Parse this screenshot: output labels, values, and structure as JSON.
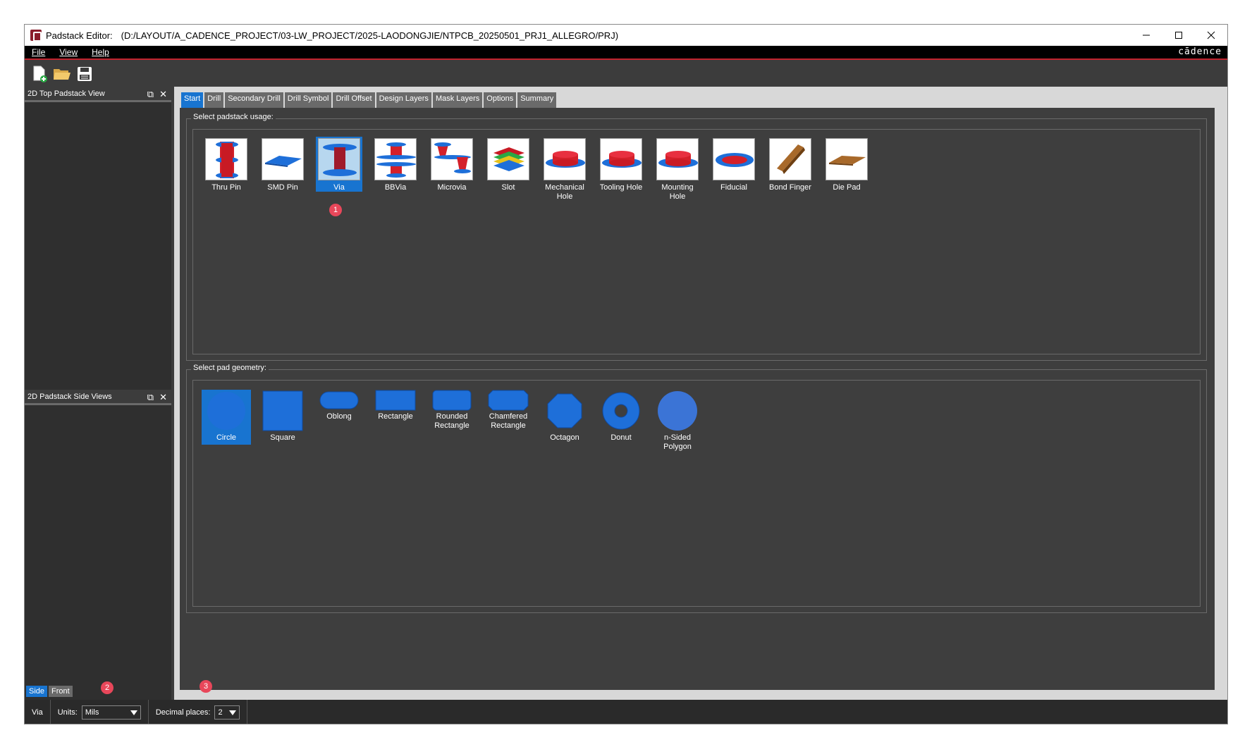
{
  "window": {
    "title": "Padstack Editor:",
    "path": "(D:/LAYOUT/A_CADENCE_PROJECT/03-LW_PROJECT/2025-LAODONGJIE/NTPCB_20250501_PRJ1_ALLEGRO/PRJ)",
    "controls": [
      "minimize",
      "maximize",
      "close"
    ]
  },
  "menu": {
    "items": [
      "File",
      "View",
      "Help"
    ],
    "brand": "cādence"
  },
  "toolbar": {
    "buttons": [
      "new-icon",
      "open-folder-icon",
      "save-icon"
    ]
  },
  "left_panels": {
    "top_title": "2D Top Padstack View",
    "side_title": "2D Padstack Side Views",
    "tabs": [
      "Side",
      "Front"
    ],
    "active_tab": "Side"
  },
  "tabs": {
    "items": [
      "Start",
      "Drill",
      "Secondary Drill",
      "Drill Symbol",
      "Drill Offset",
      "Design Layers",
      "Mask Layers",
      "Options",
      "Summary"
    ],
    "active": "Start"
  },
  "usage": {
    "title": "Select padstack usage:",
    "items": [
      {
        "label": "Thru Pin",
        "icon": "thru-pin-icon"
      },
      {
        "label": "SMD Pin",
        "icon": "smd-pin-icon"
      },
      {
        "label": "Via",
        "icon": "via-icon",
        "selected": true
      },
      {
        "label": "BBVia",
        "icon": "bbvia-icon"
      },
      {
        "label": "Microvia",
        "icon": "microvia-icon"
      },
      {
        "label": "Slot",
        "icon": "slot-icon"
      },
      {
        "label": "Mechanical Hole",
        "icon": "mechanical-hole-icon"
      },
      {
        "label": "Tooling Hole",
        "icon": "tooling-hole-icon"
      },
      {
        "label": "Mounting Hole",
        "icon": "mounting-hole-icon"
      },
      {
        "label": "Fiducial",
        "icon": "fiducial-icon"
      },
      {
        "label": "Bond Finger",
        "icon": "bond-finger-icon"
      },
      {
        "label": "Die Pad",
        "icon": "die-pad-icon"
      }
    ]
  },
  "geometry": {
    "title": "Select pad geometry:",
    "items": [
      {
        "label": "Circle",
        "icon": "circle-icon",
        "selected": true
      },
      {
        "label": "Square",
        "icon": "square-icon"
      },
      {
        "label": "Oblong",
        "icon": "oblong-icon"
      },
      {
        "label": "Rectangle",
        "icon": "rectangle-icon"
      },
      {
        "label": "Rounded Rectangle",
        "icon": "rounded-rectangle-icon"
      },
      {
        "label": "Chamfered Rectangle",
        "icon": "chamfered-rectangle-icon"
      },
      {
        "label": "Octagon",
        "icon": "octagon-icon"
      },
      {
        "label": "Donut",
        "icon": "donut-icon"
      },
      {
        "label": "n-Sided Polygon",
        "icon": "polygon-icon"
      }
    ]
  },
  "badges": [
    "1",
    "2",
    "3"
  ],
  "status": {
    "usage": "Via",
    "units_label": "Units:",
    "units_value": "Mils",
    "decimal_label": "Decimal places:",
    "decimal_value": "2"
  },
  "colors": {
    "accent": "#1874d0",
    "pad_blue": "#1e6fd9",
    "copper_red": "#d4202a",
    "badge": "#e8475a"
  }
}
